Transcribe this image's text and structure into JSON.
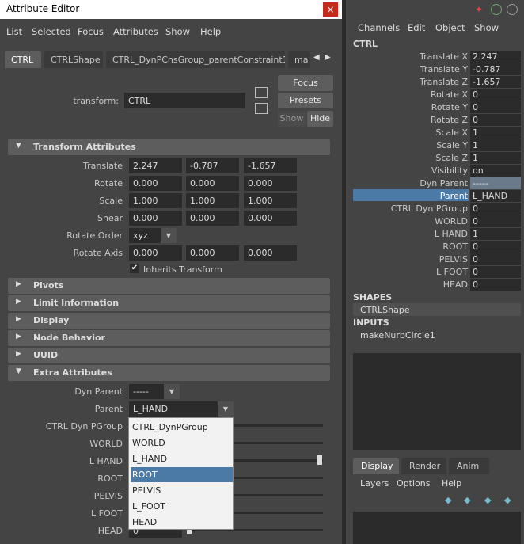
{
  "window": {
    "title": "Attribute Editor",
    "close": "×"
  },
  "menu": [
    "List",
    "Selected",
    "Focus",
    "Attributes",
    "Show",
    "Help"
  ],
  "tabs": [
    "CTRL",
    "CTRLShape",
    "CTRL_DynPCnsGroup_parentConstraint1",
    "ma"
  ],
  "transform": {
    "label": "transform:",
    "value": "CTRL"
  },
  "buttons": {
    "focus": "Focus",
    "presets": "Presets",
    "show": "Show",
    "hide": "Hide"
  },
  "sections": {
    "transform": "Transform Attributes",
    "pivots": "Pivots",
    "limit": "Limit Information",
    "display": "Display",
    "node_behavior": "Node Behavior",
    "uuid": "UUID",
    "extra": "Extra Attributes"
  },
  "attrs": {
    "translate": {
      "label": "Translate",
      "values": [
        "2.247",
        "-0.787",
        "-1.657"
      ]
    },
    "rotate": {
      "label": "Rotate",
      "values": [
        "0.000",
        "0.000",
        "0.000"
      ]
    },
    "scale": {
      "label": "Scale",
      "values": [
        "1.000",
        "1.000",
        "1.000"
      ]
    },
    "shear": {
      "label": "Shear",
      "values": [
        "0.000",
        "0.000",
        "0.000"
      ]
    },
    "rotate_order": {
      "label": "Rotate Order",
      "value": "xyz"
    },
    "rotate_axis": {
      "label": "Rotate Axis",
      "values": [
        "0.000",
        "0.000",
        "0.000"
      ]
    },
    "inherits": {
      "label": "Inherits Transform",
      "check": "✔"
    }
  },
  "extra": {
    "dyn_parent": {
      "label": "Dyn Parent",
      "value": "-----"
    },
    "parent": {
      "label": "Parent",
      "value": "L_HAND"
    },
    "rows": [
      "CTRL Dyn PGroup",
      "WORLD",
      "L HAND",
      "ROOT",
      "PELVIS",
      "L FOOT",
      "HEAD"
    ],
    "head_value": "0"
  },
  "popup": {
    "items": [
      "CTRL_DynPGroup",
      "WORLD",
      "L_HAND",
      "ROOT",
      "PELVIS",
      "L_FOOT",
      "HEAD"
    ],
    "selected_index": 3
  },
  "channelbox": {
    "menu": [
      "Channels",
      "Edit",
      "Object",
      "Show"
    ],
    "node": "CTRL",
    "channels": [
      {
        "label": "Translate X",
        "value": "2.247"
      },
      {
        "label": "Translate Y",
        "value": "-0.787"
      },
      {
        "label": "Translate Z",
        "value": "-1.657"
      },
      {
        "label": "Rotate X",
        "value": "0"
      },
      {
        "label": "Rotate Y",
        "value": "0"
      },
      {
        "label": "Rotate Z",
        "value": "0"
      },
      {
        "label": "Scale X",
        "value": "1"
      },
      {
        "label": "Scale Y",
        "value": "1"
      },
      {
        "label": "Scale Z",
        "value": "1"
      },
      {
        "label": "Visibility",
        "value": "on"
      },
      {
        "label": "Dyn Parent",
        "value": "-----"
      },
      {
        "label": "Parent",
        "value": "L_HAND"
      },
      {
        "label": "CTRL Dyn PGroup",
        "value": "0"
      },
      {
        "label": "WORLD",
        "value": "0"
      },
      {
        "label": "L HAND",
        "value": "1"
      },
      {
        "label": "ROOT",
        "value": "0"
      },
      {
        "label": "PELVIS",
        "value": "0"
      },
      {
        "label": "L FOOT",
        "value": "0"
      },
      {
        "label": "HEAD",
        "value": "0"
      }
    ],
    "selected_channel": "Parent",
    "shapes_head": "SHAPES",
    "shape": "CTRLShape",
    "inputs_head": "INPUTS",
    "input": "makeNurbCircle1",
    "bottom_tabs": [
      "Display",
      "Render",
      "Anim"
    ],
    "layer_menu": [
      "Layers",
      "Options",
      "Help"
    ]
  },
  "colors": {
    "panel": "#444444",
    "field": "#2b2b2b",
    "highlight": "#4b7aa6",
    "close": "#c42b1c"
  }
}
